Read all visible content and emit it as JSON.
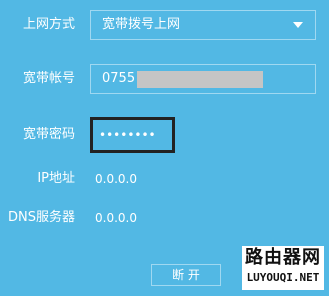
{
  "form": {
    "connection_type_label": "上网方式",
    "connection_type_value": "宽带拨号上网",
    "account_label": "宽带帐号",
    "account_value": "0755",
    "password_label": "宽带密码",
    "password_value": "••••••••",
    "ip_label": "IP地址",
    "ip_value": "0.0.0.0",
    "dns_label": "DNS服务器",
    "dns_value": "0.0.0.0",
    "disconnect_label": "断 开"
  },
  "watermark": {
    "line1": "路由器网",
    "line2": "LUYOUQI.NET"
  },
  "colors": {
    "background": "#52b8e4",
    "text": "#ffffff",
    "field_border": "#9fd8f1",
    "redaction": "#c5c5c5",
    "focus_border": "#222222"
  }
}
